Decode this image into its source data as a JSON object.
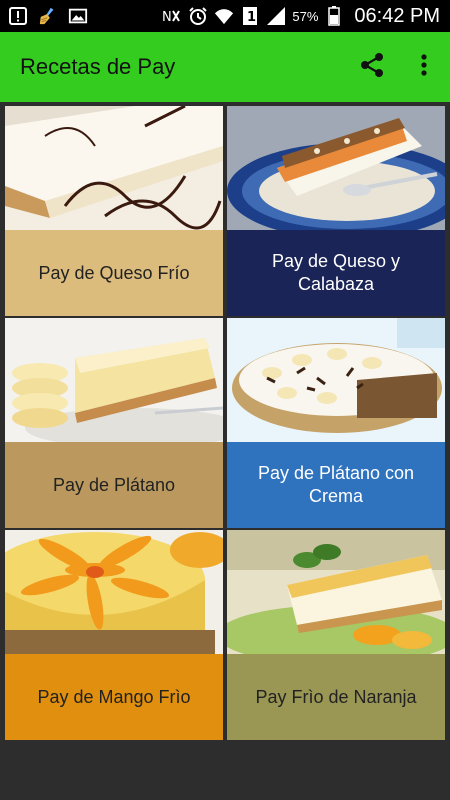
{
  "status_bar": {
    "time": "06:42 PM",
    "battery_percent": "57%",
    "sim_number": "1",
    "icons": [
      "alert-icon",
      "cleaner-icon",
      "image-icon",
      "nfc-icon",
      "alarm-icon",
      "wifi-icon",
      "sim-icon",
      "signal-icon",
      "battery-icon"
    ]
  },
  "app_bar": {
    "title": "Recetas de Pay",
    "background": "#33cc1f",
    "actions": [
      "share-icon",
      "overflow-menu-icon"
    ]
  },
  "recipes": [
    {
      "label": "Pay de Queso Frío",
      "color": "#dcbc7c",
      "text_color": "#222222"
    },
    {
      "label": "Pay de Queso y Calabaza",
      "color": "#1b2456",
      "text_color": "#ffffff"
    },
    {
      "label": "Pay de Plátano",
      "color": "#ba985e",
      "text_color": "#222222"
    },
    {
      "label": "Pay de Plátano con Crema",
      "color": "#2f72bd",
      "text_color": "#ffffff"
    },
    {
      "label": "Pay de Mango Frìo",
      "color": "#e0900e",
      "text_color": "#222222"
    },
    {
      "label": "Pay Frìo de Naranja",
      "color": "#9a9755",
      "text_color": "#222222"
    }
  ]
}
